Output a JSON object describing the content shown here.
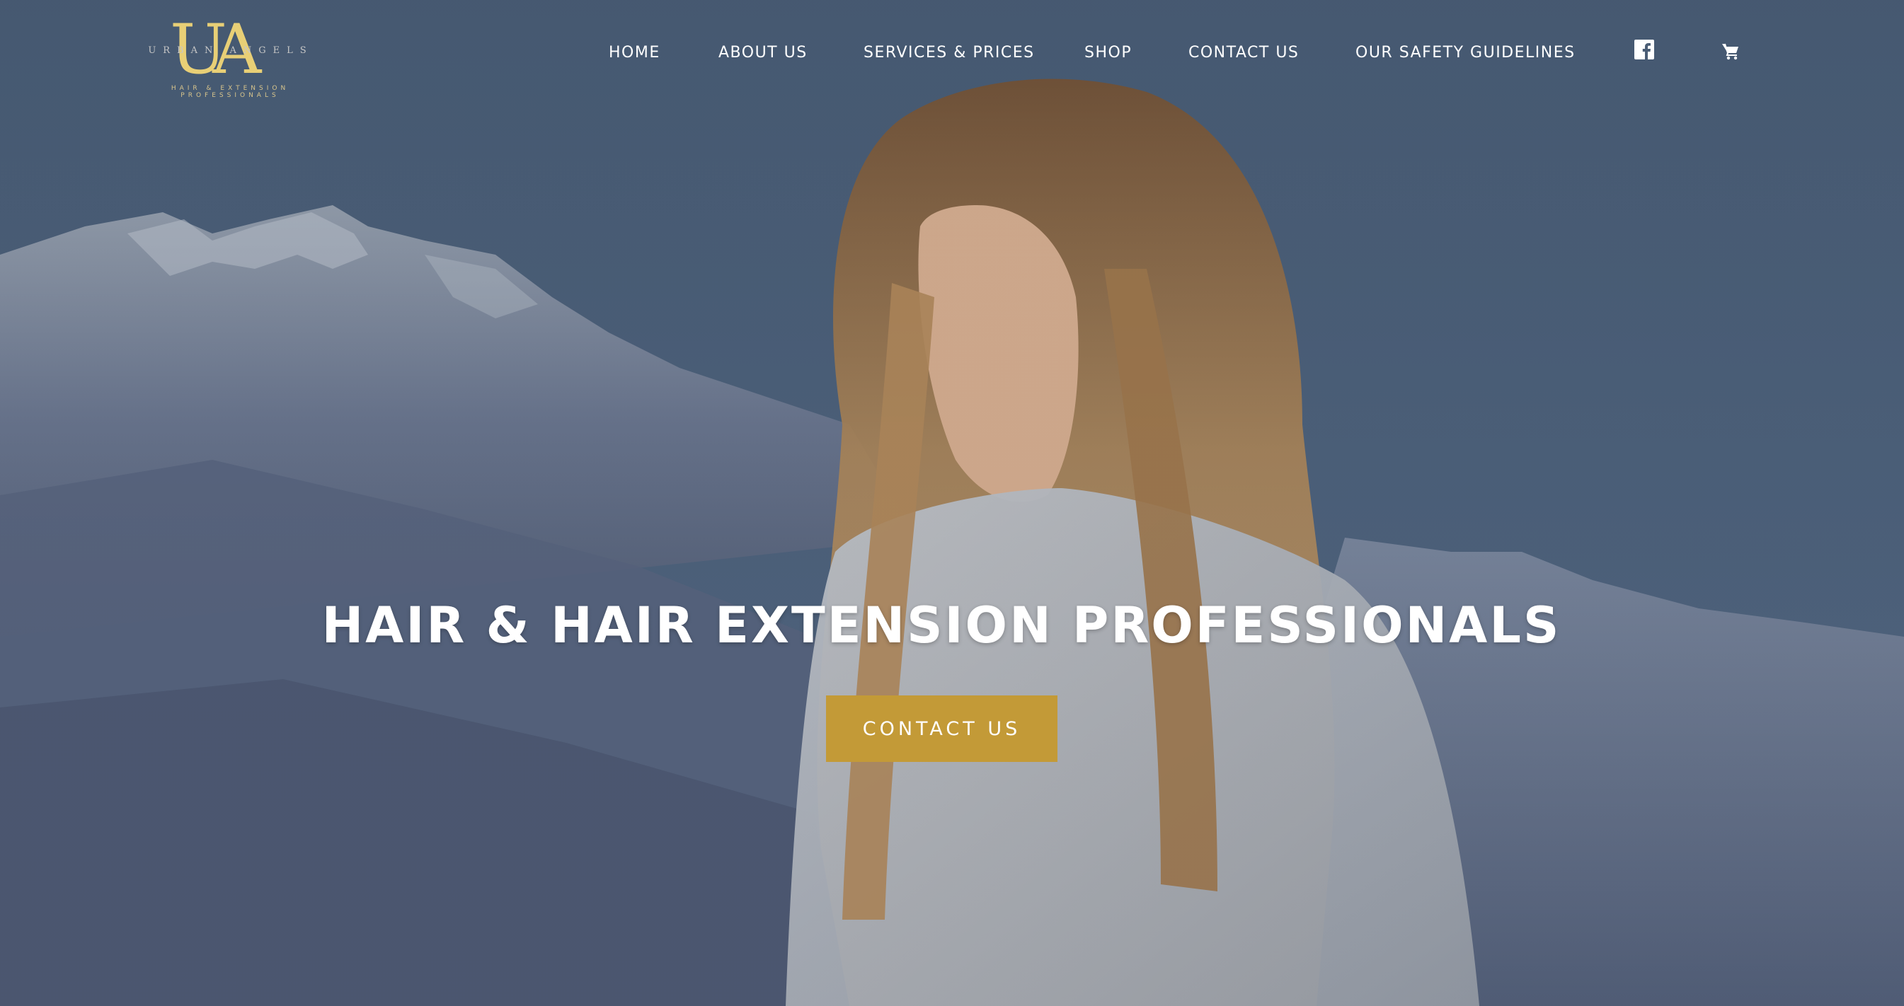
{
  "brand": {
    "monogram": "UA",
    "name": "URBAN ANGELS",
    "tagline": "HAIR & EXTENSION PROFESSIONALS"
  },
  "nav": {
    "items": [
      {
        "label": "HOME"
      },
      {
        "label": "ABOUT US"
      },
      {
        "label": "SERVICES & PRICES"
      },
      {
        "label": "SHOP"
      },
      {
        "label": "CONTACT US"
      },
      {
        "label": "OUR SAFETY GUIDELINES"
      }
    ],
    "icons": [
      "facebook-icon",
      "cart-icon"
    ]
  },
  "hero": {
    "headline": "HAIR & HAIR EXTENSION PROFESSIONALS",
    "cta_label": "CONTACT US"
  },
  "colors": {
    "accent": "#c39a37",
    "logo_gold": "#e8cf76",
    "sky": "#4a5f78",
    "nav_text": "#ffffff"
  }
}
